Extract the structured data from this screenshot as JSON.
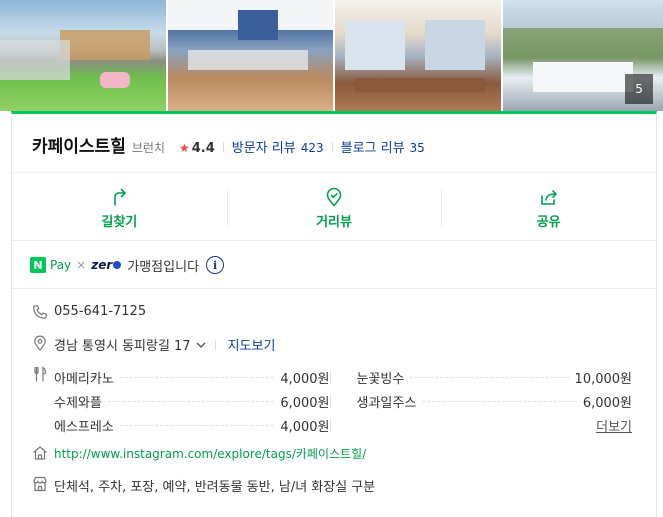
{
  "photos": {
    "count_badge": "5"
  },
  "place": {
    "name": "카페이스트힐",
    "category": "브런치",
    "star": "★",
    "rating": "4.4",
    "visitor_reviews_label": "방문자 리뷰",
    "visitor_reviews_count": "423",
    "blog_reviews_label": "블로그 리뷰",
    "blog_reviews_count": "35"
  },
  "actions": [
    {
      "label": "길찾기",
      "icon": "directions-icon"
    },
    {
      "label": "거리뷰",
      "icon": "street-view-icon"
    },
    {
      "label": "공유",
      "icon": "share-icon"
    }
  ],
  "pay": {
    "npay_logo": "N",
    "npay_text": "Pay",
    "times": "×",
    "zero_text": "zer",
    "description": "가맹점입니다",
    "info_glyph": "i"
  },
  "info": {
    "phone": "055-641-7125",
    "address": "경남 통영시 동피랑길 17",
    "map_link": "지도보기",
    "menu": [
      {
        "left": {
          "name": "아메리카노",
          "price": "4,000원"
        },
        "right": {
          "name": "눈꽃빙수",
          "price": "10,000원"
        }
      },
      {
        "left": {
          "name": "수제와플",
          "price": "6,000원"
        },
        "right": {
          "name": "생과일주스",
          "price": "6,000원"
        }
      },
      {
        "left": {
          "name": "에스프레소",
          "price": "4,000원"
        }
      }
    ],
    "more_link": "더보기",
    "url": "http://www.instagram.com/explore/tags/카페이스트힐/",
    "facilities": "단체석, 주차, 포장, 예약, 반려동물 동반, 남/녀 화장실 구분"
  },
  "colors": {
    "accent": "#03c75a",
    "link": "#0b3e9a",
    "star": "#f3454d"
  }
}
